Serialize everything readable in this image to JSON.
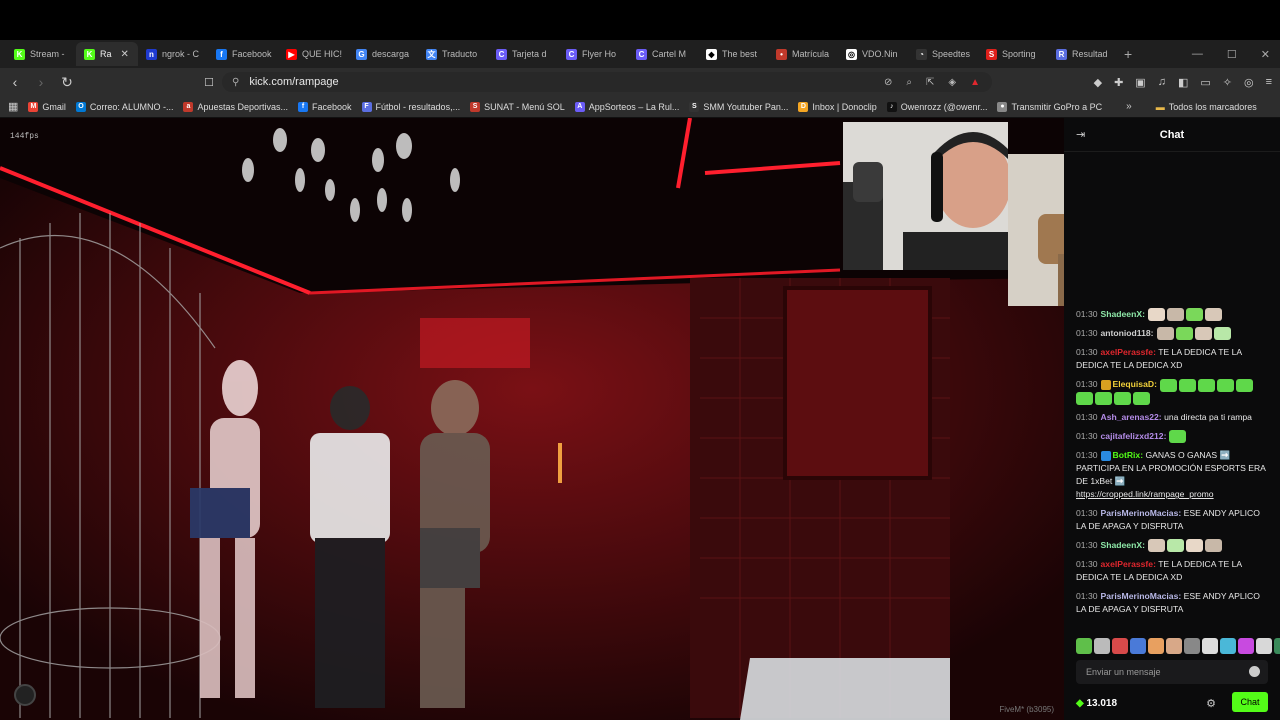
{
  "tabs": [
    {
      "label": "Stream -",
      "fav_color": "#53fc18",
      "fav_char": "K"
    },
    {
      "label": "Ra",
      "fav_color": "#53fc18",
      "fav_char": "K",
      "active": true
    },
    {
      "label": "ngrok - C",
      "fav_color": "#1f3ad0",
      "fav_char": "n"
    },
    {
      "label": "Facebook",
      "fav_color": "#1877f2",
      "fav_char": "f"
    },
    {
      "label": "QUE HIC!",
      "fav_color": "#ff0000",
      "fav_char": "▶"
    },
    {
      "label": "descarga",
      "fav_color": "#4285f4",
      "fav_char": "G"
    },
    {
      "label": "Traducto",
      "fav_color": "#4285f4",
      "fav_char": "文"
    },
    {
      "label": "Tarjeta d",
      "fav_color": "#6b5cf6",
      "fav_char": "C"
    },
    {
      "label": "Flyer Ho",
      "fav_color": "#6b5cf6",
      "fav_char": "C"
    },
    {
      "label": "Cartel M",
      "fav_color": "#6b5cf6",
      "fav_char": "C"
    },
    {
      "label": "The best",
      "fav_color": "#ffffff",
      "fav_char": "◆"
    },
    {
      "label": "Matrícula",
      "fav_color": "#c0392b",
      "fav_char": "•"
    },
    {
      "label": "VDO.Nin",
      "fav_color": "#ffffff",
      "fav_char": "◎"
    },
    {
      "label": "Speedtes",
      "fav_color": "#333333",
      "fav_char": "◔"
    },
    {
      "label": "Sporting",
      "fav_color": "#e0201b",
      "fav_char": "S"
    },
    {
      "label": "Resultad",
      "fav_color": "#5b6ee1",
      "fav_char": "R"
    }
  ],
  "address": {
    "url": "kick.com/rampage"
  },
  "bookmarks": [
    {
      "label": "Gmail",
      "fav_color": "#ea4335",
      "fav_char": "M"
    },
    {
      "label": "Correo: ALUMNO -...",
      "fav_color": "#0078d4",
      "fav_char": "O"
    },
    {
      "label": "Apuestas Deportivas...",
      "fav_color": "#c0392b",
      "fav_char": "a"
    },
    {
      "label": "Facebook",
      "fav_color": "#1877f2",
      "fav_char": "f"
    },
    {
      "label": "Fútbol - resultados,...",
      "fav_color": "#5b6ee1",
      "fav_char": "F"
    },
    {
      "label": "SUNAT - Menú SOL",
      "fav_color": "#c0392b",
      "fav_char": "S"
    },
    {
      "label": "AppSorteos – La Rul...",
      "fav_color": "#6b5cf6",
      "fav_char": "A"
    },
    {
      "label": "SMM Youtuber Pan...",
      "fav_color": "#333333",
      "fav_char": "S"
    },
    {
      "label": "Inbox | Donoclip",
      "fav_color": "#f5a623",
      "fav_char": "D"
    },
    {
      "label": "Owenrozz (@owenr...",
      "fav_color": "#111111",
      "fav_char": "♪"
    },
    {
      "label": "Transmitir GoPro a PC",
      "fav_color": "#888888",
      "fav_char": "●"
    }
  ],
  "bookmarks_all": "Todos los marcadores",
  "video": {
    "fps": "144fps",
    "fivem": "FiveM* (b3095)"
  },
  "chat": {
    "title": "Chat",
    "input_placeholder": "Enviar un mensaje",
    "points": "13.018",
    "send_label": "Chat",
    "messages": [
      {
        "time": "01:30",
        "user": "ShadeenX:",
        "color": "#8ee8a8",
        "text": "",
        "emotes": 4
      },
      {
        "time": "01:30",
        "user": "antoniod118:",
        "color": "#cfcfcf",
        "text": "",
        "emotes": 4
      },
      {
        "time": "01:30",
        "user": "axelPerassfe:",
        "color": "#e0272e",
        "text": "TE LA DEDICA TE LA DEDICA TE LA DEDICA XD",
        "emotes": 0
      },
      {
        "time": "01:30",
        "user": "ElequisaD:",
        "color": "#f0d03a",
        "text": "",
        "emotes": 9
      },
      {
        "time": "01:30",
        "user": "Ash_arenas22:",
        "color": "#b48ce8",
        "text": "una directa pa ti rampa",
        "emotes": 0
      },
      {
        "time": "01:30",
        "user": "cajitafelizxd212:",
        "color": "#b48ce8",
        "text": "",
        "emotes": 1
      },
      {
        "time": "01:30",
        "user": "BotRix:",
        "color": "#53fc18",
        "text": "GANAS O GANAS ➡️ PARTICIPA EN LA PROMOCIÓN ESPORTS ERA DE 1xBet ➡️",
        "link": "https://cropped.link/rampage_promo",
        "emotes": 0
      },
      {
        "time": "01:30",
        "user": "ParisMerinoMacias:",
        "color": "#b9b9e8",
        "text": "ESE ANDY APLICO LA DE APAGA Y DISFRUTA",
        "emotes": 0
      },
      {
        "time": "01:30",
        "user": "ShadeenX:",
        "color": "#8ee8a8",
        "text": "",
        "emotes": 4
      },
      {
        "time": "01:30",
        "user": "axelPerassfe:",
        "color": "#e0272e",
        "text": "TE LA DEDICA TE LA DEDICA TE LA DEDICA XD",
        "emotes": 0
      },
      {
        "time": "01:30",
        "user": "ParisMerinoMacias:",
        "color": "#b9b9e8",
        "text": "ESE ANDY APLICO LA DE APAGA Y DISFRUTA",
        "emotes": 0
      }
    ]
  }
}
